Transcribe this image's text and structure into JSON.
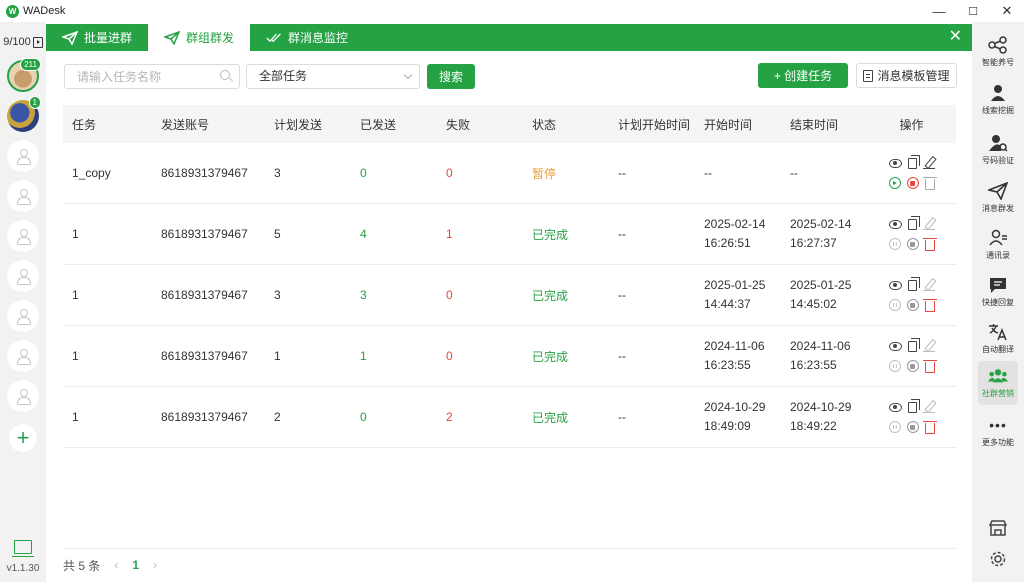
{
  "window": {
    "app_name": "WADesk",
    "minimize": "—",
    "maximize": "☐",
    "close": "✕"
  },
  "accounts": {
    "count": "9/100",
    "badges": [
      "211",
      "1"
    ],
    "version": "v1.1.30"
  },
  "tabs": [
    {
      "label": "批量进群",
      "icon": "send-icon"
    },
    {
      "label": "群组群发",
      "icon": "send-icon"
    },
    {
      "label": "群消息监控",
      "icon": "double-check-icon"
    }
  ],
  "toolbar": {
    "search_placeholder": "请输入任务名称",
    "filter_value": "全部任务",
    "search_button": "搜索",
    "create_button": "+ 创建任务",
    "template_button": "消息模板管理"
  },
  "table": {
    "headers": [
      "任务",
      "发送账号",
      "计划发送",
      "已发送",
      "失败",
      "状态",
      "计划开始时间",
      "开始时间",
      "结束时间",
      "操作"
    ],
    "rows": [
      {
        "task": "1_copy",
        "account": "8618931379467",
        "planned": "3",
        "sent": "0",
        "failed": "0",
        "status": "暂停",
        "plan_start": "--",
        "start_date": "--",
        "start_time": "",
        "end_date": "--",
        "end_time": ""
      },
      {
        "task": "1",
        "account": "8618931379467",
        "planned": "5",
        "sent": "4",
        "failed": "1",
        "status": "已完成",
        "plan_start": "--",
        "start_date": "2025-02-14",
        "start_time": "16:26:51",
        "end_date": "2025-02-14",
        "end_time": "16:27:37"
      },
      {
        "task": "1",
        "account": "8618931379467",
        "planned": "3",
        "sent": "3",
        "failed": "0",
        "status": "已完成",
        "plan_start": "--",
        "start_date": "2025-01-25",
        "start_time": "14:44:37",
        "end_date": "2025-01-25",
        "end_time": "14:45:02"
      },
      {
        "task": "1",
        "account": "8618931379467",
        "planned": "1",
        "sent": "1",
        "failed": "0",
        "status": "已完成",
        "plan_start": "--",
        "start_date": "2024-11-06",
        "start_time": "16:23:55",
        "end_date": "2024-11-06",
        "end_time": "16:23:55"
      },
      {
        "task": "1",
        "account": "8618931379467",
        "planned": "2",
        "sent": "0",
        "failed": "2",
        "status": "已完成",
        "plan_start": "--",
        "start_date": "2024-10-29",
        "start_time": "18:49:09",
        "end_date": "2024-10-29",
        "end_time": "18:49:22"
      }
    ]
  },
  "pager": {
    "total": "共 5 条",
    "prev": "‹",
    "page": "1",
    "next": "›"
  },
  "right_nav": [
    {
      "label": "智能养号",
      "icon": "share-nodes-icon"
    },
    {
      "label": "线索挖掘",
      "icon": "user-pin-icon"
    },
    {
      "label": "号码验证",
      "icon": "user-search-icon"
    },
    {
      "label": "消息群发",
      "icon": "send-icon"
    },
    {
      "label": "通讯录",
      "icon": "contacts-icon"
    },
    {
      "label": "快捷回复",
      "icon": "chat-icon"
    },
    {
      "label": "自动翻译",
      "icon": "translate-icon"
    },
    {
      "label": "社群营销",
      "icon": "group-icon"
    },
    {
      "label": "更多功能",
      "icon": "more-icon"
    }
  ]
}
